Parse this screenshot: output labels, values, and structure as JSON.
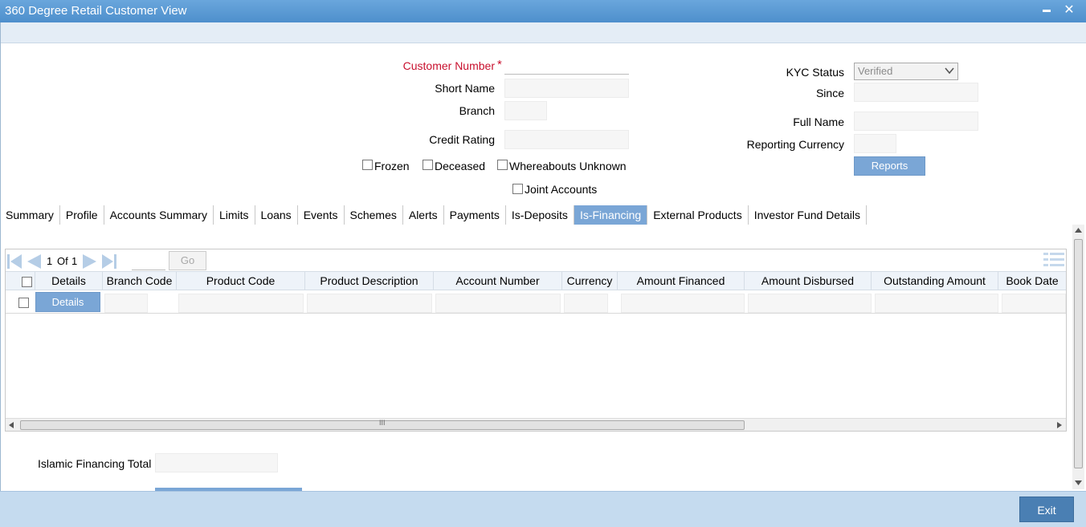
{
  "window": {
    "title": "360 Degree Retail Customer View",
    "minimize": "▬",
    "close": "✕"
  },
  "form": {
    "customer_number_label": "Customer Number",
    "required_mark": "*",
    "short_name_label": "Short Name",
    "branch_label": "Branch",
    "credit_rating_label": "Credit Rating",
    "kyc_status_label": "KYC Status",
    "kyc_status_value": "Verified",
    "since_label": "Since",
    "full_name_label": "Full Name",
    "reporting_currency_label": "Reporting Currency",
    "reports_button": "Reports",
    "frozen_label": "Frozen",
    "deceased_label": "Deceased",
    "whereabouts_label": "Whereabouts Unknown",
    "joint_accounts_label": "Joint Accounts"
  },
  "tabs": [
    {
      "label": "Summary",
      "active": false
    },
    {
      "label": "Profile",
      "active": false
    },
    {
      "label": "Accounts Summary",
      "active": false
    },
    {
      "label": "Limits",
      "active": false
    },
    {
      "label": "Loans",
      "active": false
    },
    {
      "label": "Events",
      "active": false
    },
    {
      "label": "Schemes",
      "active": false
    },
    {
      "label": "Alerts",
      "active": false
    },
    {
      "label": "Payments",
      "active": false
    },
    {
      "label": "Is-Deposits",
      "active": false
    },
    {
      "label": "Is-Financing",
      "active": true
    },
    {
      "label": "External Products",
      "active": false
    },
    {
      "label": "Investor Fund Details",
      "active": false
    }
  ],
  "grid": {
    "pager_current": "1",
    "pager_of": "Of",
    "pager_total": "1",
    "go_label": "Go",
    "columns": [
      "Details",
      "Branch Code",
      "Product Code",
      "Product Description",
      "Account Number",
      "Currency",
      "Amount Financed",
      "Amount Disbursed",
      "Outstanding Amount",
      "Book Date"
    ],
    "row_details_button": "Details",
    "scroll_grip": "III"
  },
  "totals": {
    "islamic_financing_total_label": "Islamic Financing Total"
  },
  "footer": {
    "exit_label": "Exit"
  },
  "colors": {
    "accent": "#7aa6d6",
    "required": "#c8102e",
    "titlebar": "#5b9bd5"
  }
}
